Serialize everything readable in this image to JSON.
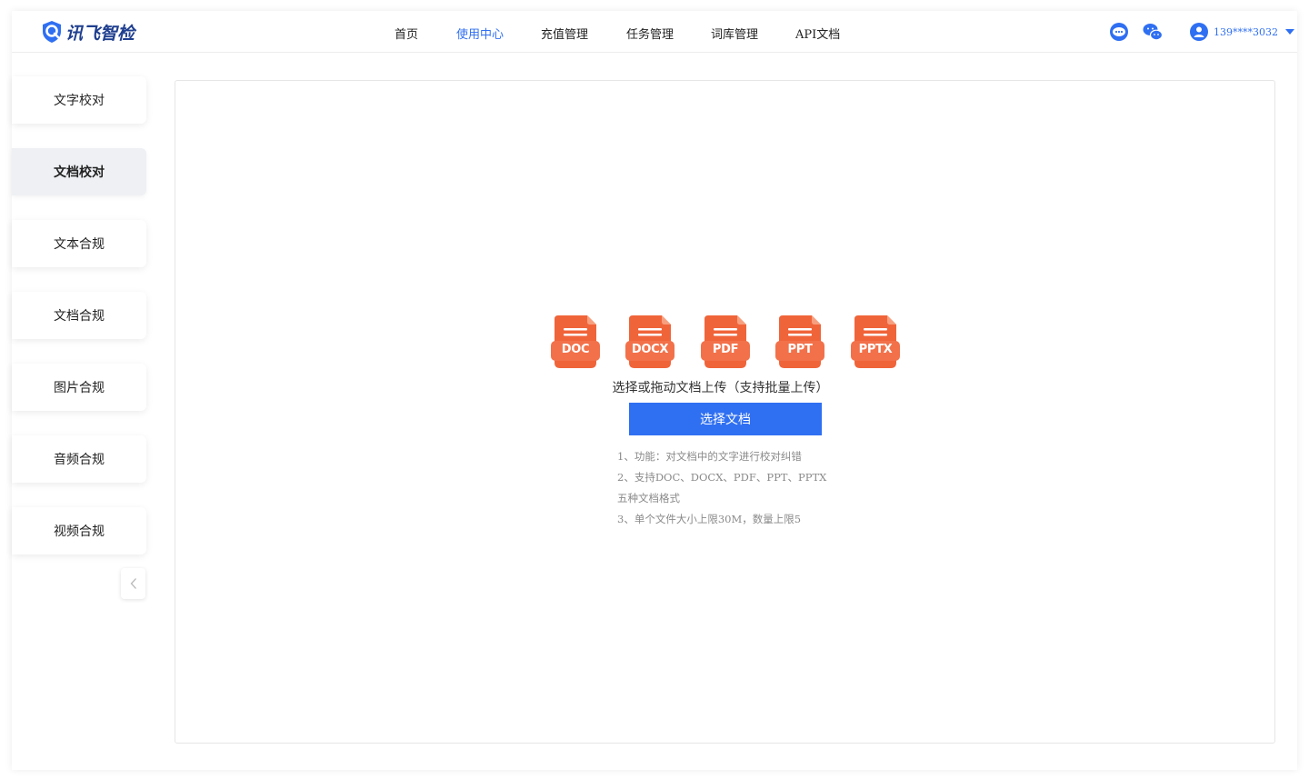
{
  "header": {
    "logo_text": "讯飞智检",
    "nav": [
      {
        "label": "首页",
        "active": false
      },
      {
        "label": "使用中心",
        "active": true
      },
      {
        "label": "充值管理",
        "active": false
      },
      {
        "label": "任务管理",
        "active": false
      },
      {
        "label": "词库管理",
        "active": false
      },
      {
        "label": "API文档",
        "active": false
      }
    ],
    "icons": [
      "chat-bubble-icon",
      "wechat-icon"
    ],
    "user": {
      "phone": "139****3032",
      "avatar_icon": "user-avatar-icon",
      "caret_icon": "caret-down-icon"
    }
  },
  "sidebar": {
    "items": [
      {
        "label": "文字校对",
        "active": false
      },
      {
        "label": "文档校对",
        "active": true
      },
      {
        "label": "文本合规",
        "active": false
      },
      {
        "label": "文档合规",
        "active": false
      },
      {
        "label": "图片合规",
        "active": false
      },
      {
        "label": "音频合规",
        "active": false
      },
      {
        "label": "视频合规",
        "active": false
      }
    ],
    "collapse_icon": "chevron-left-icon"
  },
  "upload": {
    "formats": [
      "DOC",
      "DOCX",
      "PDF",
      "PPT",
      "PPTX"
    ],
    "hint": "选择或拖动文档上传（支持批量上传）",
    "button_label": "选择文档",
    "notes": [
      "1、功能：对文档中的文字进行校对纠错",
      "2、支持DOC、DOCX、PDF、PPT、PPTX",
      "五种文档格式",
      "3、单个文件大小上限30M，数量上限5"
    ]
  },
  "colors": {
    "accent": "#2f6ff2",
    "file_icon": "#f0643a",
    "sidebar_active_bg": "#eef0f3"
  }
}
